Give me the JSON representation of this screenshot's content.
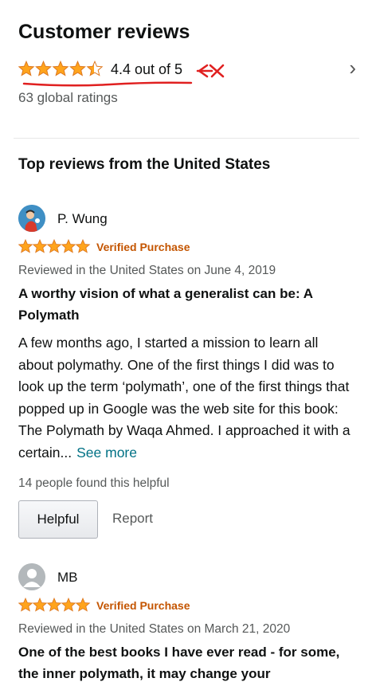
{
  "header": {
    "title": "Customer reviews"
  },
  "summary": {
    "rating_value": 4.4,
    "rating_text": "4.4 out of 5",
    "global_ratings": "63 global ratings"
  },
  "section": {
    "title": "Top reviews from the United States"
  },
  "reviews": [
    {
      "name": "P. Wung",
      "stars": 5,
      "verified": "Verified Purchase",
      "date": "Reviewed in the United States on June 4, 2019",
      "title": "A worthy vision of what a generalist can be: A Polymath",
      "body": "A few months ago, I started a mission to learn all about polymathy. One of the first things I did was to look up the term ‘polymath’, one of the first things that popped up in Google was the web site for this book: The Polymath by Waqa Ahmed. I approached it with a certain...",
      "see_more": "See more",
      "helpful_count": "14 people found this helpful",
      "helpful_label": "Helpful",
      "report_label": "Report"
    },
    {
      "name": "MB",
      "stars": 5,
      "verified": "Verified Purchase",
      "date": "Reviewed in the United States on March 21, 2020",
      "title": "One of the best books I have ever read - for some, the inner polymath, it may change your"
    }
  ],
  "colors": {
    "star": "#ffa41c",
    "star_stroke": "#de7921",
    "verified": "#c45500",
    "link": "#007185",
    "annotation": "#e02020"
  }
}
